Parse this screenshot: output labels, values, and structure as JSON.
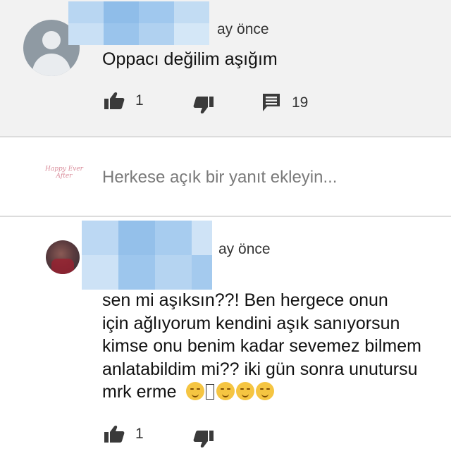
{
  "comment1": {
    "time": "ay önce",
    "text": "Oppacı değilim aşığım",
    "likes": "1",
    "replies": "19"
  },
  "reply_box": {
    "placeholder": "Herkese açık bir yanıt ekleyin...",
    "logo_text": "Happy Ever After"
  },
  "comment2": {
    "time": "ay önce",
    "lines": [
      "sen mi aşıksın??! Ben hergece onun",
      "için ağlıyorum kendini aşık sanıyorsun",
      "kimse onu benim kadar sevemez bilmem",
      "anlatabildim mi?? iki gün sonra unutursu",
      "mrk erme"
    ],
    "likes": "1"
  },
  "icons": [
    "thumb-up-icon",
    "thumb-down-icon",
    "reply-icon",
    "avatar-icon",
    "emoji-icon"
  ],
  "colors": {
    "top_bg": "#f2f2f2",
    "blur": "#a9cdf0",
    "emoji": "#f5c542"
  }
}
